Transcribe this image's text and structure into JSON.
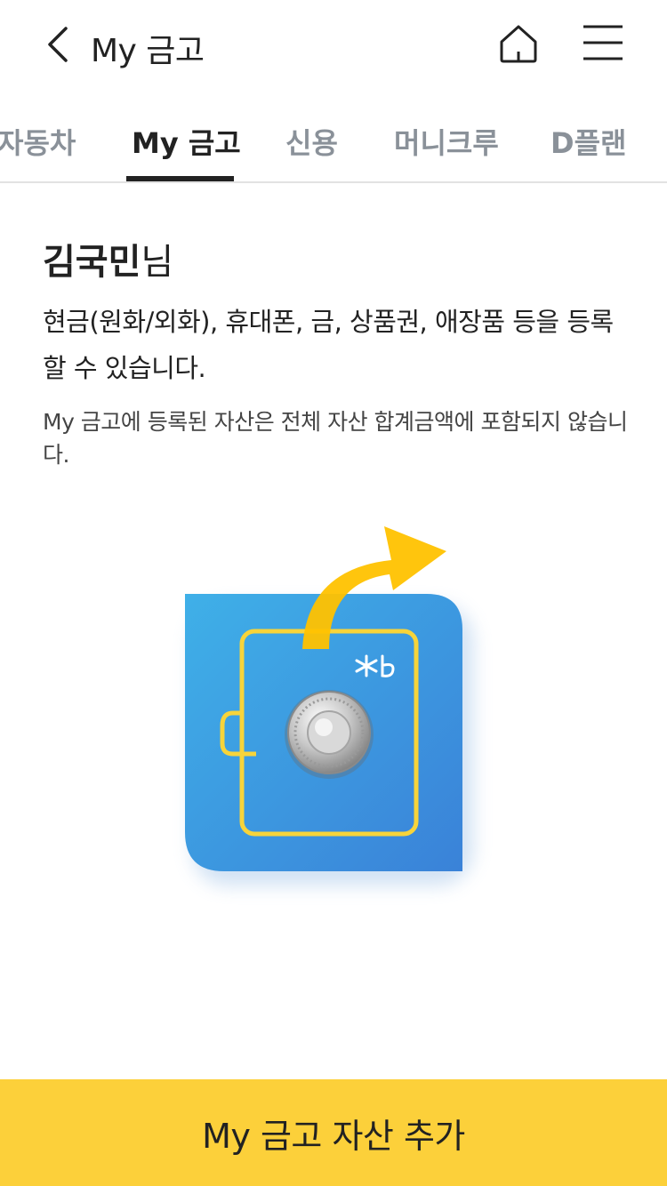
{
  "header": {
    "title": "My 금고",
    "back_icon": "chevron-left-icon",
    "home_icon": "home-icon",
    "menu_icon": "hamburger-menu-icon"
  },
  "tabs": [
    {
      "label": "자동차",
      "active": false
    },
    {
      "label": "My 금고",
      "active": true
    },
    {
      "label": "신용",
      "active": false
    },
    {
      "label": "머니크루",
      "active": false
    },
    {
      "label": "D플랜",
      "active": false
    }
  ],
  "intro": {
    "name": "김국민",
    "suffix": "님",
    "description": "현금(원화/외화), 휴대폰, 금, 상품권, 애장품 등을 등록할 수 있습니다.",
    "note": "My 금고에 등록된 자산은 전체 자산 합계금액에 포함되지 않습니다."
  },
  "illustration": {
    "icon": "safe-icon",
    "colors": {
      "safe": "#3f8fdc",
      "frame": "#f7d43a",
      "arrow": "#ffc200",
      "shadow_arc": "#5e5448"
    }
  },
  "cta": {
    "label": "My 금고 자산 추가",
    "color": "#fcd03a"
  }
}
